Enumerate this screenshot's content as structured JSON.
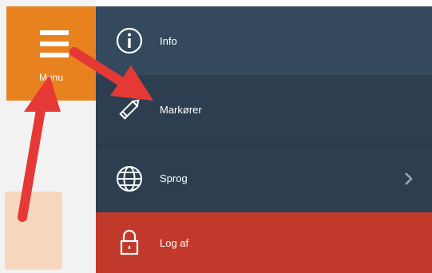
{
  "left": {
    "menu_button": {
      "label": "Menu",
      "icon": "hamburger-icon"
    }
  },
  "nav": {
    "items": [
      {
        "label": "Info",
        "icon": "info-icon"
      },
      {
        "label": "Markører",
        "icon": "pencil-icon"
      },
      {
        "label": "Sprog",
        "icon": "globe-icon",
        "trailing_icon": "chevron-right-icon"
      },
      {
        "label": "Log af",
        "icon": "lock-icon"
      }
    ]
  },
  "colors": {
    "menu_tile": "#e8821f",
    "nav_top": "#34495e",
    "nav_dark": "#2c3e50",
    "logout": "#c0392b",
    "annotation_arrow": "#e53935"
  }
}
